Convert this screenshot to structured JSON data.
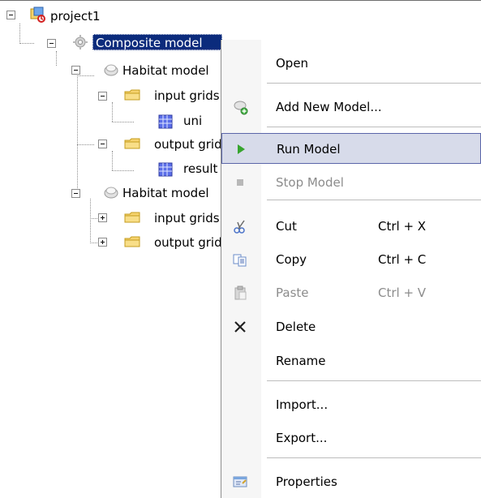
{
  "tree": {
    "root": {
      "label": "project1",
      "icon": "project-icon"
    },
    "composite": {
      "label": "Composite model",
      "icon": "gear-icon",
      "selected": true
    },
    "habitat1": {
      "label": "Habitat model",
      "icon": "model-icon"
    },
    "input_grids_1": {
      "label": "input grids",
      "icon": "folder-icon"
    },
    "uni": {
      "label": "uni",
      "icon": "grid-icon"
    },
    "output_grids_1": {
      "label": "output grids",
      "icon": "folder-icon"
    },
    "result": {
      "label": "result",
      "icon": "grid-icon"
    },
    "habitat2": {
      "label": "Habitat model",
      "icon": "model-icon"
    },
    "input_grids_2": {
      "label": "input grids",
      "icon": "folder-icon"
    },
    "output_grids_2": {
      "label": "output grids",
      "icon": "folder-icon"
    }
  },
  "menu": {
    "items": [
      {
        "label": "Open",
        "shortcut": "",
        "icon": "",
        "enabled": true,
        "highlighted": false
      },
      {
        "label": "Add New Model...",
        "shortcut": "",
        "icon": "add-model-icon",
        "enabled": true,
        "highlighted": false
      },
      {
        "label": "Run Model",
        "shortcut": "",
        "icon": "play-icon",
        "enabled": true,
        "highlighted": true
      },
      {
        "label": "Stop Model",
        "shortcut": "",
        "icon": "stop-icon",
        "enabled": false,
        "highlighted": false
      },
      {
        "label": "Cut",
        "shortcut": "Ctrl + X",
        "icon": "scissors-icon",
        "enabled": true,
        "highlighted": false
      },
      {
        "label": "Copy",
        "shortcut": "Ctrl + C",
        "icon": "copy-icon",
        "enabled": true,
        "highlighted": false
      },
      {
        "label": "Paste",
        "shortcut": "Ctrl + V",
        "icon": "paste-icon",
        "enabled": false,
        "highlighted": false
      },
      {
        "label": "Delete",
        "shortcut": "",
        "icon": "close-icon",
        "enabled": true,
        "highlighted": false
      },
      {
        "label": "Rename",
        "shortcut": "",
        "icon": "",
        "enabled": true,
        "highlighted": false
      },
      {
        "label": "Import...",
        "shortcut": "",
        "icon": "",
        "enabled": true,
        "highlighted": false
      },
      {
        "label": "Export...",
        "shortcut": "",
        "icon": "",
        "enabled": true,
        "highlighted": false
      },
      {
        "label": "Properties",
        "shortcut": "",
        "icon": "properties-icon",
        "enabled": true,
        "highlighted": false
      }
    ]
  },
  "colors": {
    "selection_bg": "#0b2b7c",
    "menu_highlight_bg": "#d7dbea",
    "menu_highlight_border": "#5b66a9",
    "disabled_text": "#8c8c8c"
  }
}
